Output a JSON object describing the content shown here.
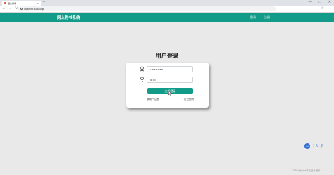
{
  "browser": {
    "tab_title": "图片登录",
    "tab_close": "×",
    "new_tab": "+",
    "url": "localhost:8080/login",
    "nav": {
      "back": "←",
      "forward": "→",
      "reload": "↻"
    },
    "window_controls": {
      "minimize": "—",
      "maximize": "□",
      "close": "✕"
    },
    "toolbar_icons": [
      "☆",
      "⋯"
    ]
  },
  "navbar": {
    "brand": "网上购书系统",
    "links": [
      "登录",
      "注册"
    ]
  },
  "login": {
    "title": "用户登录",
    "username_value": "aaaaaaa",
    "password_value": "•••••",
    "button_label": "立即登录",
    "link_register": "新用户注册",
    "link_forgot": "忘记密码"
  },
  "floating": {
    "badge": "du",
    "icons": [
      "☽",
      "↻",
      "⚲"
    ]
  },
  "watermark": "CSDN @java毕业设计程序",
  "colors": {
    "accent": "#119b88",
    "background": "#e9e9e9"
  }
}
